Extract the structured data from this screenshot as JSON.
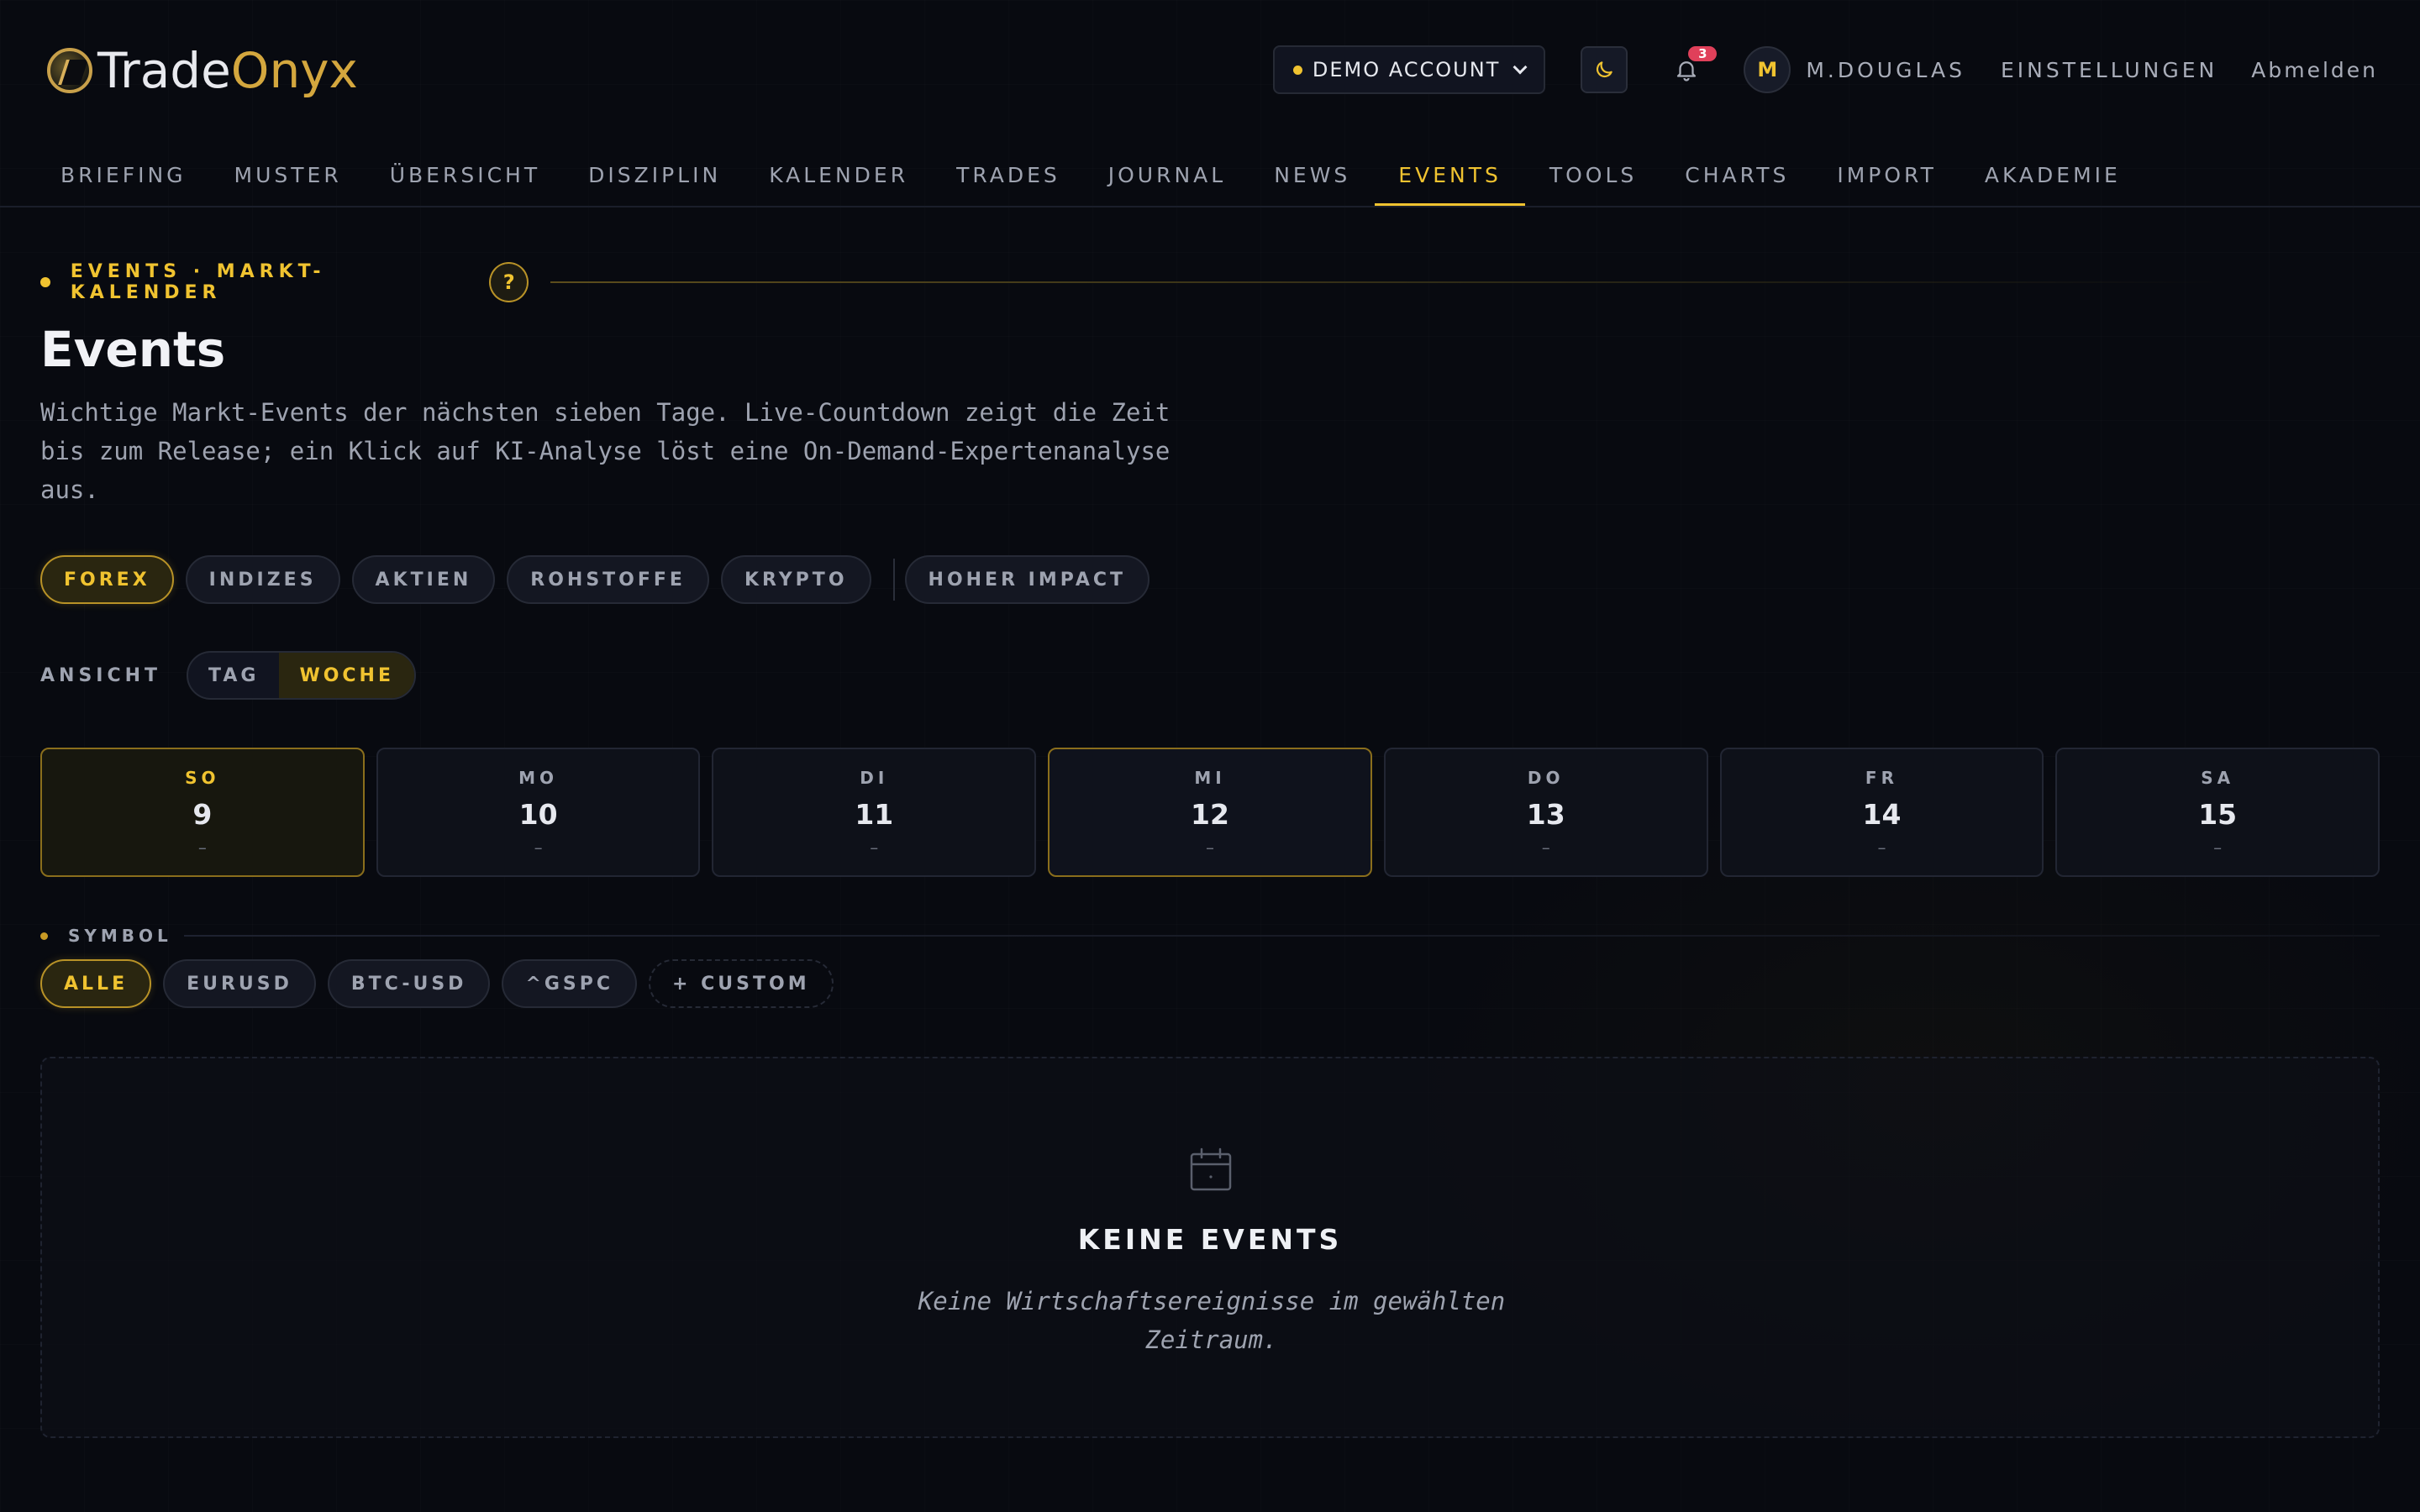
{
  "app": {
    "logo_part1": "Trade",
    "logo_part2": "Onyx"
  },
  "header": {
    "account_label": "DEMO ACCOUNT",
    "notification_count": "3",
    "avatar_initial": "M",
    "username": "M.DOUGLAS",
    "settings_label": "EINSTELLUNGEN",
    "logout_label": "Abmelden"
  },
  "nav": {
    "items": [
      {
        "label": "BRIEFING"
      },
      {
        "label": "MUSTER"
      },
      {
        "label": "ÜBERSICHT"
      },
      {
        "label": "DISZIPLIN"
      },
      {
        "label": "KALENDER"
      },
      {
        "label": "TRADES"
      },
      {
        "label": "JOURNAL"
      },
      {
        "label": "NEWS"
      },
      {
        "label": "EVENTS"
      },
      {
        "label": "TOOLS"
      },
      {
        "label": "CHARTS"
      },
      {
        "label": "IMPORT"
      },
      {
        "label": "AKADEMIE"
      }
    ],
    "active": "EVENTS"
  },
  "page": {
    "breadcrumb": "EVENTS · MARKT-KALENDER",
    "help_label": "?",
    "title": "Events",
    "description": "Wichtige Markt-Events der nächsten sieben Tage. Live-Countdown zeigt die Zeit bis zum Release; ein Klick auf KI-Analyse löst eine On-Demand-Expertenanalyse aus."
  },
  "filters": {
    "categories": [
      "FOREX",
      "INDIZES",
      "AKTIEN",
      "ROHSTOFFE",
      "KRYPTO"
    ],
    "active_category": "FOREX",
    "impact_label": "HOHER IMPACT"
  },
  "view": {
    "label": "ANSICHT",
    "day_label": "TAG",
    "week_label": "WOCHE",
    "active": "WOCHE"
  },
  "days": [
    {
      "name": "SO",
      "num": "9",
      "count": "–"
    },
    {
      "name": "MO",
      "num": "10",
      "count": "–"
    },
    {
      "name": "DI",
      "num": "11",
      "count": "–"
    },
    {
      "name": "MI",
      "num": "12",
      "count": "–"
    },
    {
      "name": "DO",
      "num": "13",
      "count": "–"
    },
    {
      "name": "FR",
      "num": "14",
      "count": "–"
    },
    {
      "name": "SA",
      "num": "15",
      "count": "–"
    }
  ],
  "symbol": {
    "label": "SYMBOL",
    "items": [
      "ALLE",
      "EURUSD",
      "BTC-USD",
      "^GSPC"
    ],
    "active": "ALLE",
    "custom_label": "+ CUSTOM"
  },
  "empty": {
    "title": "KEINE EVENTS",
    "text": "Keine Wirtschaftsereignisse im gewählten Zeitraum."
  },
  "colors": {
    "accent": "#f0c330",
    "background": "#080a10",
    "badge": "#e0405a"
  }
}
